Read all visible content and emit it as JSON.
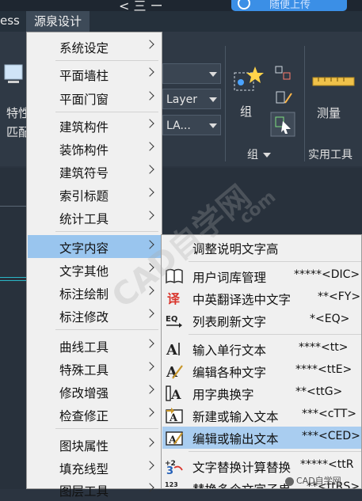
{
  "top": {
    "cloud_button_label": "随便上传",
    "left_glyph": "< 三 ー"
  },
  "menubar": {
    "partial_item": "ess",
    "active_item": "源泉设计"
  },
  "ribbon": {
    "combo_layer": "Layer",
    "combo_la": "LA...",
    "label_tebie": "特性",
    "label_pipei": "匹配",
    "label_zu": "组",
    "label_celiang": "测量",
    "panel_zu": "组",
    "panel_shiyong": "实用工具"
  },
  "menu": {
    "items": [
      {
        "label": "系统设定"
      },
      {
        "label": "平面墙柱"
      },
      {
        "label": "平面门窗"
      },
      {
        "label": "建筑构件"
      },
      {
        "label": "装饰构件"
      },
      {
        "label": "建筑符号"
      },
      {
        "label": "索引标题"
      },
      {
        "label": "统计工具"
      },
      {
        "label": "文字内容"
      },
      {
        "label": "文字其他"
      },
      {
        "label": "标注绘制"
      },
      {
        "label": "标注修改"
      },
      {
        "label": "曲线工具"
      },
      {
        "label": "特殊工具"
      },
      {
        "label": "修改增强"
      },
      {
        "label": "检查修正"
      },
      {
        "label": "图块属性"
      },
      {
        "label": "填充线型"
      },
      {
        "label": "图层工具"
      }
    ]
  },
  "submenu": {
    "items": [
      {
        "label": "调整说明文字高",
        "shortcut": ""
      },
      {
        "label": "用户词库管理",
        "shortcut": "*****<DIC>"
      },
      {
        "label": "中英翻译选中文字",
        "shortcut": "**<FY>"
      },
      {
        "label": "列表刷新文字",
        "shortcut": "*<EQ>"
      },
      {
        "label": "输入单行文本",
        "shortcut": "****<tt>"
      },
      {
        "label": "编辑各种文字",
        "shortcut": "****<ttE>"
      },
      {
        "label": "用字典换字",
        "shortcut": "**<ttG>"
      },
      {
        "label": "新建或输入文本",
        "shortcut": "***<cTT>"
      },
      {
        "label": "编辑或输出文本",
        "shortcut": "***<CED>"
      },
      {
        "label": "文字替换计算替换",
        "shortcut": "*****<ttR"
      },
      {
        "label": "替换多个文字子串",
        "shortcut": "**<ttRS>"
      }
    ]
  },
  "watermark": {
    "text": "CAD自学网",
    "url_fragment": "com",
    "badge": "CAD自学网"
  },
  "colors": {
    "menu_bg": "#f0f0f0",
    "highlight": "#99c5ee",
    "app_bg": "#2b3440",
    "accent_blue": "#3b8fe6"
  }
}
